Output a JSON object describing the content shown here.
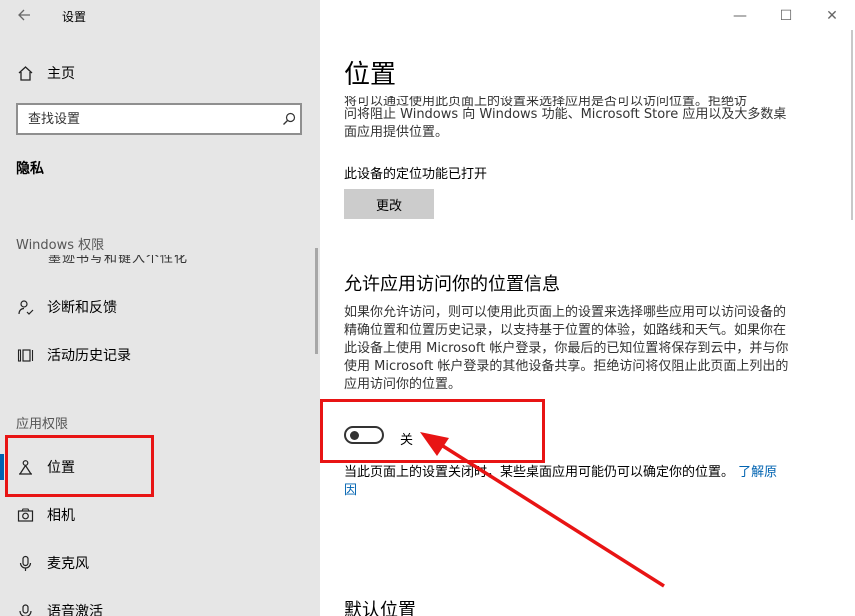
{
  "window": {
    "title": "设置",
    "controls": {
      "minimize": "—",
      "maximize": "☐",
      "close": "✕"
    }
  },
  "sidebar": {
    "home_label": "主页",
    "search_placeholder": "查找设置",
    "category_title": "隐私",
    "groups": {
      "windows_permissions": "Windows 权限",
      "app_permissions": "应用权限"
    },
    "partial_item_text": "墨迹书写和键入个性化",
    "items": [
      {
        "id": "diagnostics",
        "label": "诊断和反馈",
        "icon": "diagnostics-icon"
      },
      {
        "id": "activity",
        "label": "活动历史记录",
        "icon": "activity-history-icon"
      },
      {
        "id": "location",
        "label": "位置",
        "icon": "location-icon",
        "active": true
      },
      {
        "id": "camera",
        "label": "相机",
        "icon": "camera-icon"
      },
      {
        "id": "microphone",
        "label": "麦克风",
        "icon": "microphone-icon"
      },
      {
        "id": "voice",
        "label": "语音激活",
        "icon": "voice-activation-icon"
      }
    ]
  },
  "main": {
    "page_title": "位置",
    "intro_cut": "将可以通过使用此页面上的设置来选择应用是否可以访问位置。拒绝访",
    "intro_rest": "问将阻止 Windows 向 Windows 功能、Microsoft Store 应用以及大多数桌面应用提供位置。",
    "device_status": "此设备的定位功能已打开",
    "change_button": "更改",
    "allow_heading": "允许应用访问你的位置信息",
    "allow_desc": "如果你允许访问，则可以使用此页面上的设置来选择哪些应用可以访问设备的精确位置和位置历史记录，以支持基于位置的体验，如路线和天气。如果你在此设备上使用 Microsoft 帐户登录，你最后的已知位置将保存到云中，并与你使用 Microsoft 帐户登录的其他设备共享。拒绝访问将仅阻止此页面上列出的应用访问你的位置。",
    "toggle_state_label": "关",
    "toggle_on": false,
    "note_text": "当此页面上的设置关闭时，某些桌面应用可能仍可以确定你的位置。",
    "note_link": "了解原因",
    "default_heading": "默认位置"
  },
  "colors": {
    "accent": "#0063b1",
    "annotation": "#e81414",
    "sidebar_bg": "#e6e6e6"
  }
}
